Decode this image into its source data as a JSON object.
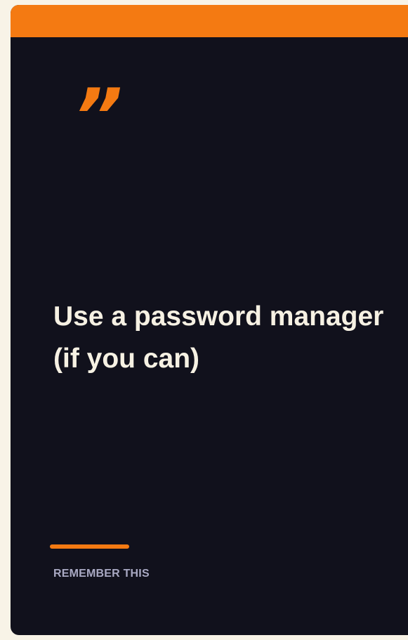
{
  "card": {
    "quote_glyph": "”",
    "headline": "Use a password manager (if you can)",
    "caption": "REMEMBER THIS"
  },
  "colors": {
    "page_background": "#f8f3e7",
    "card_background": "#11111c",
    "accent": "#f47a12",
    "headline_text": "#f6f1e3",
    "caption_text": "#a9a9c3"
  },
  "icons": {
    "quote_mark": "closing-quote-icon"
  }
}
